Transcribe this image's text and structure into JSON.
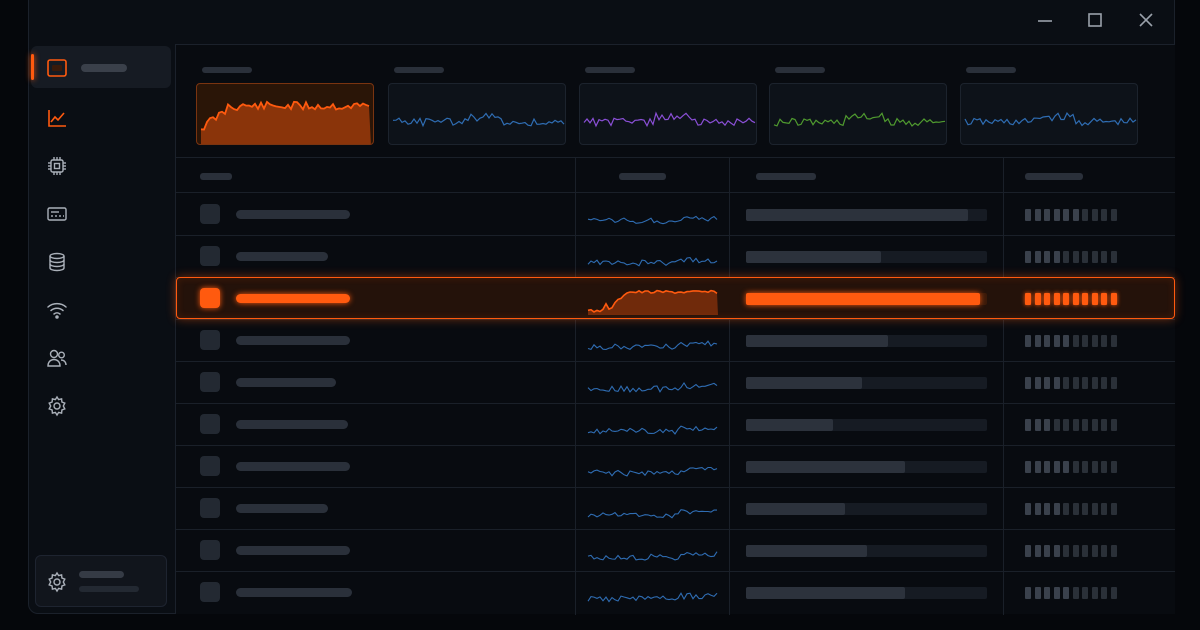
{
  "theme": {
    "accent": "#ff5a0f",
    "background": "#0a0e14",
    "muted": "#2a303a"
  },
  "window_controls": [
    "minimize-icon",
    "maximize-icon",
    "close-icon"
  ],
  "sidebar": {
    "items": [
      {
        "icon": "dashboard-icon",
        "active": true
      },
      {
        "icon": "chart-line-icon",
        "active": false
      },
      {
        "icon": "cpu-chip-icon",
        "active": false
      },
      {
        "icon": "memory-card-icon",
        "active": false
      },
      {
        "icon": "database-icon",
        "active": false
      },
      {
        "icon": "wifi-icon",
        "active": false
      },
      {
        "icon": "users-icon",
        "active": false
      },
      {
        "icon": "gear-icon",
        "active": false
      }
    ],
    "footer_icon": "gear-icon"
  },
  "metrics": [
    {
      "color": "#ff5a0f",
      "active": true
    },
    {
      "color": "#2f6db3",
      "active": false
    },
    {
      "color": "#8a4fd6",
      "active": false
    },
    {
      "color": "#4f9a2f",
      "active": false
    },
    {
      "color": "#2f6db3",
      "active": false
    }
  ],
  "rows": [
    {
      "bar": 0.92,
      "segments_on": 6,
      "selected": false
    },
    {
      "bar": 0.56,
      "segments_on": 4,
      "selected": false
    },
    {
      "bar": 0.97,
      "segments_on": 10,
      "selected": true
    },
    {
      "bar": 0.59,
      "segments_on": 5,
      "selected": false
    },
    {
      "bar": 0.48,
      "segments_on": 4,
      "selected": false
    },
    {
      "bar": 0.36,
      "segments_on": 3,
      "selected": false
    },
    {
      "bar": 0.66,
      "segments_on": 5,
      "selected": false
    },
    {
      "bar": 0.41,
      "segments_on": 4,
      "selected": false
    },
    {
      "bar": 0.5,
      "segments_on": 4,
      "selected": false
    },
    {
      "bar": 0.66,
      "segments_on": 5,
      "selected": false
    }
  ],
  "segment_count": 10
}
